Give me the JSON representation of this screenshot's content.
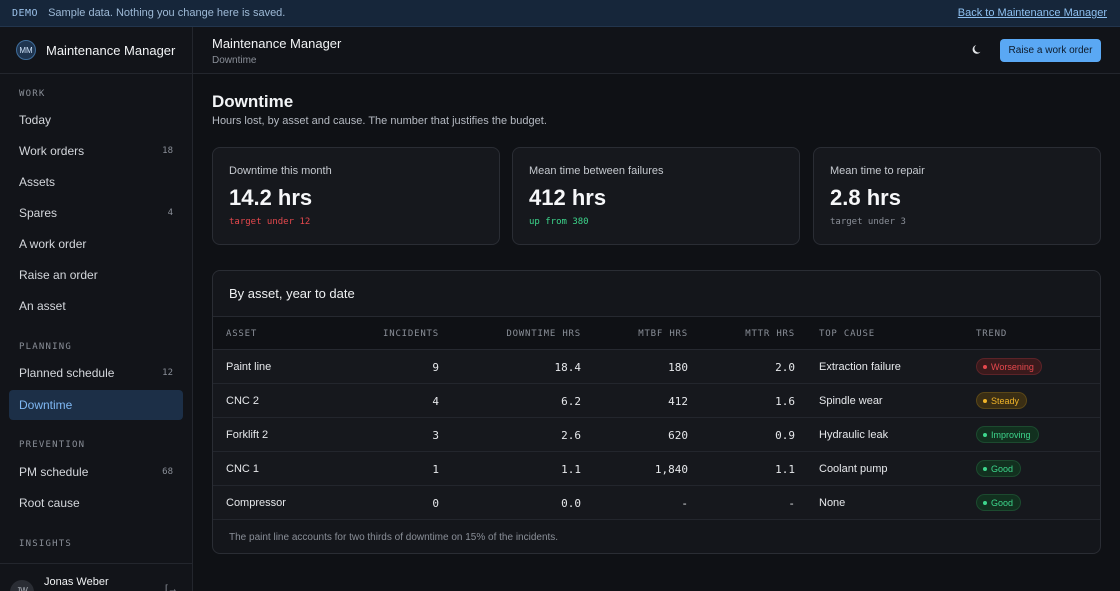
{
  "banner": {
    "tag": "DEMO",
    "message": "Sample data. Nothing you change here is saved.",
    "back_link": "Back to Maintenance Manager"
  },
  "sidebar": {
    "brand_initials": "MM",
    "brand_name": "Maintenance Manager",
    "sections": [
      {
        "label": "WORK"
      },
      {
        "label": "PLANNING"
      },
      {
        "label": "PREVENTION"
      },
      {
        "label": "INSIGHTS"
      }
    ],
    "items": [
      {
        "label": "Today",
        "count": ""
      },
      {
        "label": "Work orders",
        "count": "18"
      },
      {
        "label": "Assets",
        "count": ""
      },
      {
        "label": "Spares",
        "count": "4"
      },
      {
        "label": "A work order",
        "count": ""
      },
      {
        "label": "Raise an order",
        "count": ""
      },
      {
        "label": "An asset",
        "count": ""
      },
      {
        "label": "Planned schedule",
        "count": "12"
      },
      {
        "label": "Downtime",
        "count": ""
      },
      {
        "label": "PM schedule",
        "count": "68"
      },
      {
        "label": "Root cause",
        "count": ""
      }
    ],
    "user": {
      "initials": "JW",
      "name": "Jonas Weber",
      "logout": "[→"
    }
  },
  "header": {
    "title": "Maintenance Manager",
    "breadcrumb": "Downtime",
    "theme_icon": "moon-icon",
    "primary_button": "Raise a work order"
  },
  "page": {
    "title": "Downtime",
    "subtitle": "Hours lost, by asset and cause. The number that justifies the budget."
  },
  "stats": [
    {
      "label": "Downtime this month",
      "value": "14.2 hrs",
      "note": "target under 12",
      "note_color": "#e5484d"
    },
    {
      "label": "Mean time between failures",
      "value": "412 hrs",
      "note": "up from 380",
      "note_color": "#3dd68c"
    },
    {
      "label": "Mean time to repair",
      "value": "2.8 hrs",
      "note": "target under 3",
      "note_color": "#8a8f98"
    }
  ],
  "table": {
    "title": "By asset, year to date",
    "columns": [
      "ASSET",
      "INCIDENTS",
      "DOWNTIME HRS",
      "MTBF HRS",
      "MTTR HRS",
      "TOP CAUSE",
      "TREND"
    ],
    "rows": [
      {
        "asset": "Paint line",
        "incidents": "9",
        "downtime": "18.4",
        "mtbf": "180",
        "mttr": "2.0",
        "cause": "Extraction failure",
        "trend": "Worsening",
        "trend_color": "#e5484d",
        "trend_bg": "#3a1a1c",
        "trend_border": "#5c2328"
      },
      {
        "asset": "CNC 2",
        "incidents": "4",
        "downtime": "6.2",
        "mtbf": "412",
        "mttr": "1.6",
        "cause": "Spindle wear",
        "trend": "Steady",
        "trend_color": "#f0b429",
        "trend_bg": "#3a2e14",
        "trend_border": "#5a4718"
      },
      {
        "asset": "Forklift 2",
        "incidents": "3",
        "downtime": "2.6",
        "mtbf": "620",
        "mttr": "0.9",
        "cause": "Hydraulic leak",
        "trend": "Improving",
        "trend_color": "#3dd68c",
        "trend_bg": "#12301f",
        "trend_border": "#1c4a2f"
      },
      {
        "asset": "CNC 1",
        "incidents": "1",
        "downtime": "1.1",
        "mtbf": "1,840",
        "mttr": "1.1",
        "cause": "Coolant pump",
        "trend": "Good",
        "trend_color": "#3dd68c",
        "trend_bg": "#12301f",
        "trend_border": "#1c4a2f"
      },
      {
        "asset": "Compressor",
        "incidents": "0",
        "downtime": "0.0",
        "mtbf": "-",
        "mttr": "-",
        "cause": "None",
        "trend": "Good",
        "trend_color": "#3dd68c",
        "trend_bg": "#12301f",
        "trend_border": "#1c4a2f"
      }
    ],
    "footnote": "The paint line accounts for two thirds of downtime on 15% of the incidents."
  }
}
